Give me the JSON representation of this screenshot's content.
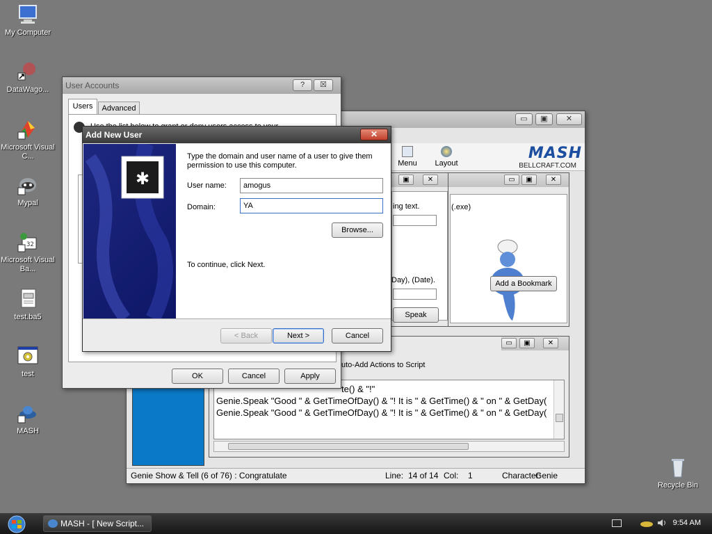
{
  "desktop": {
    "icons": [
      {
        "label": "My Computer",
        "icon": "computer-icon"
      },
      {
        "label": "DataWago...",
        "icon": "datawagon-icon"
      },
      {
        "label": "Microsoft Visual C...",
        "icon": "visual-c-icon"
      },
      {
        "label": "Mypal",
        "icon": "mypal-icon"
      },
      {
        "label": "Microsoft Visual Ba...",
        "icon": "visual-basic-icon"
      },
      {
        "label": "test.ba5",
        "icon": "document-icon"
      },
      {
        "label": "test",
        "icon": "app-gear-icon"
      },
      {
        "label": "MASH",
        "icon": "mash-genie-icon"
      },
      {
        "label": "Recycle Bin",
        "icon": "recycle-bin-icon"
      }
    ]
  },
  "user_accounts": {
    "title": "User Accounts",
    "help_glyph": "?",
    "close_glyph": "☒",
    "tabs": [
      "Users",
      "Advanced"
    ],
    "intro_text": "Use the list below to grant or deny users access to your",
    "buttons": {
      "ok": "OK",
      "cancel": "Cancel",
      "apply": "Apply"
    }
  },
  "add_user": {
    "title": "Add New User",
    "instruction": "Type the domain and user name of a user to give them permission to use this computer.",
    "username_label": "User name:",
    "username_value": "amogus",
    "domain_label": "Domain:",
    "domain_value": "YA",
    "browse_label": "Browse...",
    "continue_text": "To continue, click Next.",
    "back_label": "< Back",
    "next_label": "Next >",
    "cancel_label": "Cancel",
    "close_glyph": "✕"
  },
  "mash": {
    "toolbar": {
      "menu": "Menu",
      "layout": "Layout"
    },
    "logo": {
      "brand": "MASH",
      "site": "BELLCRAFT.COM"
    },
    "panel1": {
      "line1": "ing text.",
      "line2": "Day), (Date).",
      "speak": "Speak"
    },
    "panel2": {
      "text": "(.exe)",
      "bookmark": "Add a Bookmark"
    },
    "script_header": "uto-Add Actions to Script",
    "script_lines": [
      "te() & \"!\"",
      "Genie.Speak \"Good \" & GetTimeOfDay() & \"!  It is \" & GetTime() & \" on \" & GetDay(",
      "Genie.Speak \"Good \" & GetTimeOfDay() & \"!  It is \" & GetTime() & \" on \" & GetDay("
    ],
    "status": {
      "message": "Genie Show & Tell (6 of 76) : Congratulate",
      "line_label": "Line:",
      "line_value": "14 of 14",
      "col_label": "Col:",
      "col_value": "1",
      "char_label": "Character:",
      "char_value": "Genie"
    }
  },
  "taskbar": {
    "task_label": "MASH - [ New Script...",
    "clock": "9:54 AM"
  },
  "colors": {
    "desktop": "#7a7a7a",
    "banner": "#1e2880",
    "mash_blue": "#0a7ac8"
  }
}
